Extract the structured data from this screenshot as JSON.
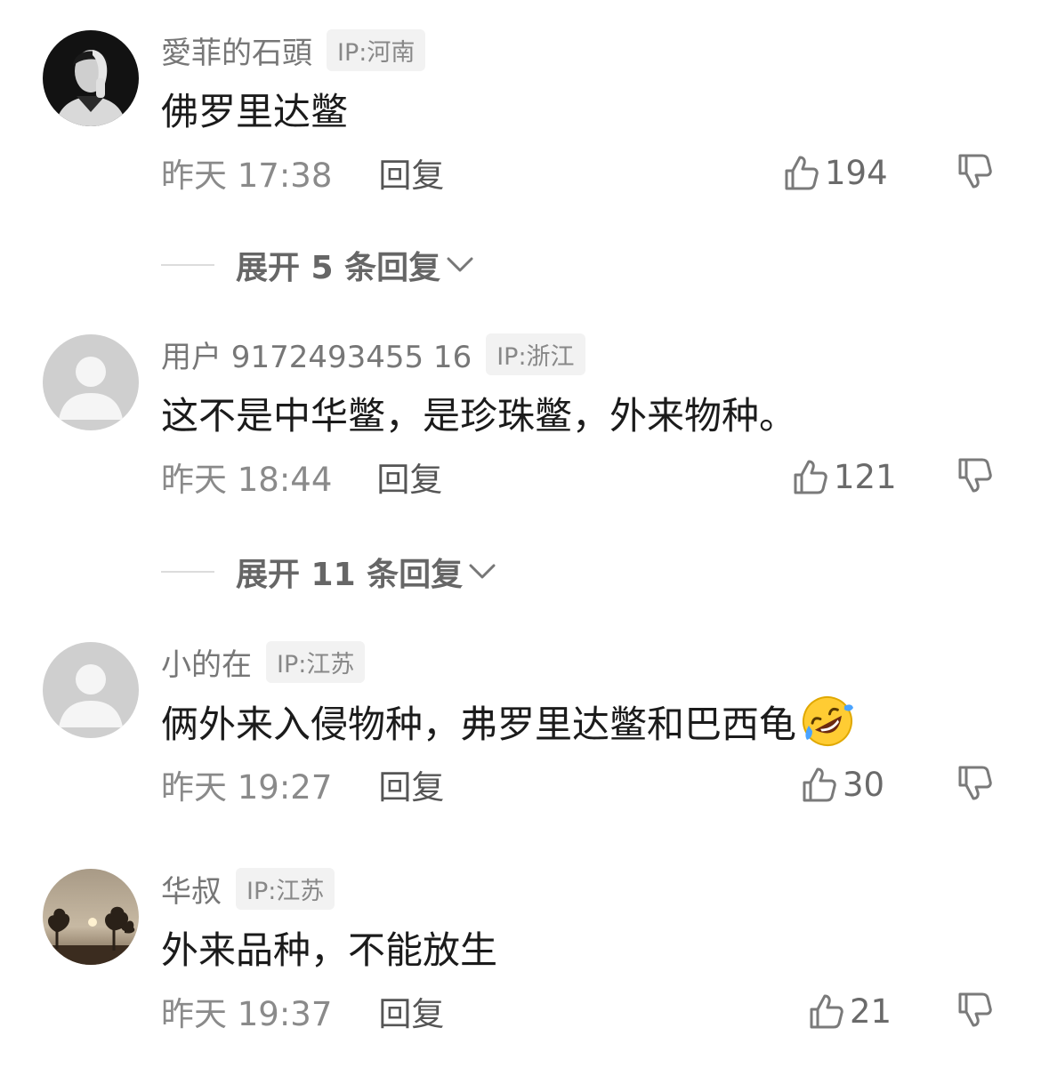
{
  "comments": [
    {
      "author": "愛菲的石頭",
      "ip": "IP:河南",
      "text": "佛罗里达鳖",
      "time": "昨天 17:38",
      "reply_label": "回复",
      "likes": "194",
      "avatar": "photo-man-hand-on-face-icon",
      "expand_label": "展开 5 条回复"
    },
    {
      "author": "用户 9172493455 16",
      "ip": "IP:浙江",
      "text": "这不是中华鳖，是珍珠鳖，外来物种。",
      "time": "昨天 18:44",
      "reply_label": "回复",
      "likes": "121",
      "avatar": "default-user-icon",
      "expand_label": "展开 11 条回复"
    },
    {
      "author": "小的在",
      "ip": "IP:江苏",
      "text": "俩外来入侵物种，弗罗里达鳖和巴西龟",
      "emoji": "rolling-on-floor-laughing-emoji",
      "time": "昨天 19:27",
      "reply_label": "回复",
      "likes": "30",
      "avatar": "default-user-icon"
    },
    {
      "author": "华叔",
      "ip": "IP:江苏",
      "text": "外来品种，不能放生",
      "time": "昨天 19:37",
      "reply_label": "回复",
      "likes": "21",
      "avatar": "photo-sunset-trees-icon"
    }
  ],
  "icons": {
    "like": "thumbs-up-icon",
    "dislike": "thumbs-down-icon",
    "expand": "chevron-down-icon"
  },
  "colors": {
    "name": "#777777",
    "text": "#1b1b1b",
    "meta": "#8a8a8a",
    "badge_bg": "#f2f2f2"
  }
}
